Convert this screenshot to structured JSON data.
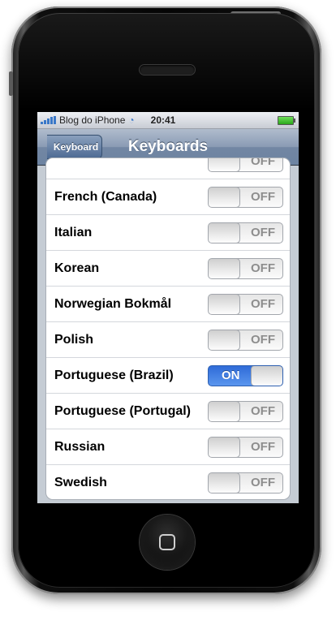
{
  "status_bar": {
    "carrier": "Blog do iPhone",
    "time": "20:41",
    "wifi_icon": "wifi-icon",
    "battery_level": 1.0
  },
  "nav": {
    "back_label": "Keyboard",
    "title": "Keyboards"
  },
  "keyboards": [
    {
      "label": "",
      "state": "OFF"
    },
    {
      "label": "French (Canada)",
      "state": "OFF"
    },
    {
      "label": "Italian",
      "state": "OFF"
    },
    {
      "label": "Korean",
      "state": "OFF"
    },
    {
      "label": "Norwegian Bokmål",
      "state": "OFF"
    },
    {
      "label": "Polish",
      "state": "OFF"
    },
    {
      "label": "Portuguese (Brazil)",
      "state": "ON"
    },
    {
      "label": "Portuguese (Portugal)",
      "state": "OFF"
    },
    {
      "label": "Russian",
      "state": "OFF"
    },
    {
      "label": "Swedish",
      "state": "OFF"
    }
  ],
  "colors": {
    "switch_on": "#2f6bd8",
    "nav_bar": "#6d84a2",
    "list_background": "#c5ccd4"
  }
}
